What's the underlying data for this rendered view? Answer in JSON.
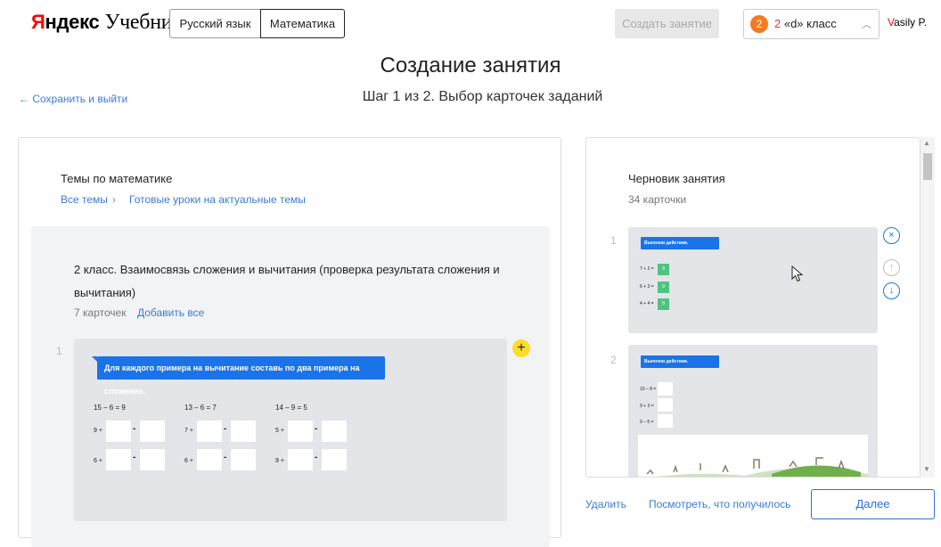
{
  "header": {
    "logo_brand_y": "Я",
    "logo_brand_rest": "ндекс",
    "logo_product": "Учебник",
    "subjects": [
      "Русский язык",
      "Математика"
    ],
    "create_button": "Создать занятие",
    "class_selector": {
      "badge": "2",
      "grade": "2",
      "label": " «d» класс"
    },
    "user": {
      "first_letter": "V",
      "rest": "asily P."
    }
  },
  "page": {
    "title": "Создание занятия",
    "step": "Шаг 1 из 2. Выбор карточек заданий",
    "save_exit": "← Сохранить и выйти"
  },
  "left": {
    "title": "Темы по математике",
    "breadcrumb": [
      "Все темы",
      "›",
      "Готовые уроки на актуальные темы"
    ],
    "topic": {
      "title": "2 класс. Взаимосвязь сложения и вычитания (проверка результата сложения и вычитания)",
      "count": "7 карточек",
      "add_all": "Добавить все"
    },
    "card": {
      "number": "1",
      "banner": "Для каждого примера на вычитание составь по два примера на сложение.",
      "columns": [
        {
          "eq": "15 – 6 = 9",
          "rows": [
            "9 +",
            "6 +"
          ]
        },
        {
          "eq": "13 – 6 = 7",
          "rows": [
            "7 +",
            "6 +"
          ]
        },
        {
          "eq": "14 – 9 = 5",
          "rows": [
            "5 +",
            "9 +"
          ]
        }
      ],
      "dash": "-",
      "add_icon": "+"
    }
  },
  "right": {
    "title": "Черновик занятия",
    "count": "34 карточки",
    "cards": [
      {
        "number": "1",
        "banner": "Выполни действия.",
        "rows": [
          {
            "label": "7 + 2 =",
            "val": "9"
          },
          {
            "label": "6 + 3 =",
            "val": "9"
          },
          {
            "label": "4 + 4 =",
            "val": "8"
          }
        ]
      },
      {
        "number": "2",
        "banner": "Выполни действия.",
        "rows": [
          {
            "label": "10 – 8 ="
          },
          {
            "label": "9 + 3 ="
          },
          {
            "label": "9 – 6 ="
          }
        ]
      }
    ],
    "icons": {
      "remove": "×",
      "up": "↑",
      "down": "↓"
    }
  },
  "footer": {
    "delete": "Удалить",
    "preview": "Посмотреть, что получилось",
    "next": "Далее"
  }
}
